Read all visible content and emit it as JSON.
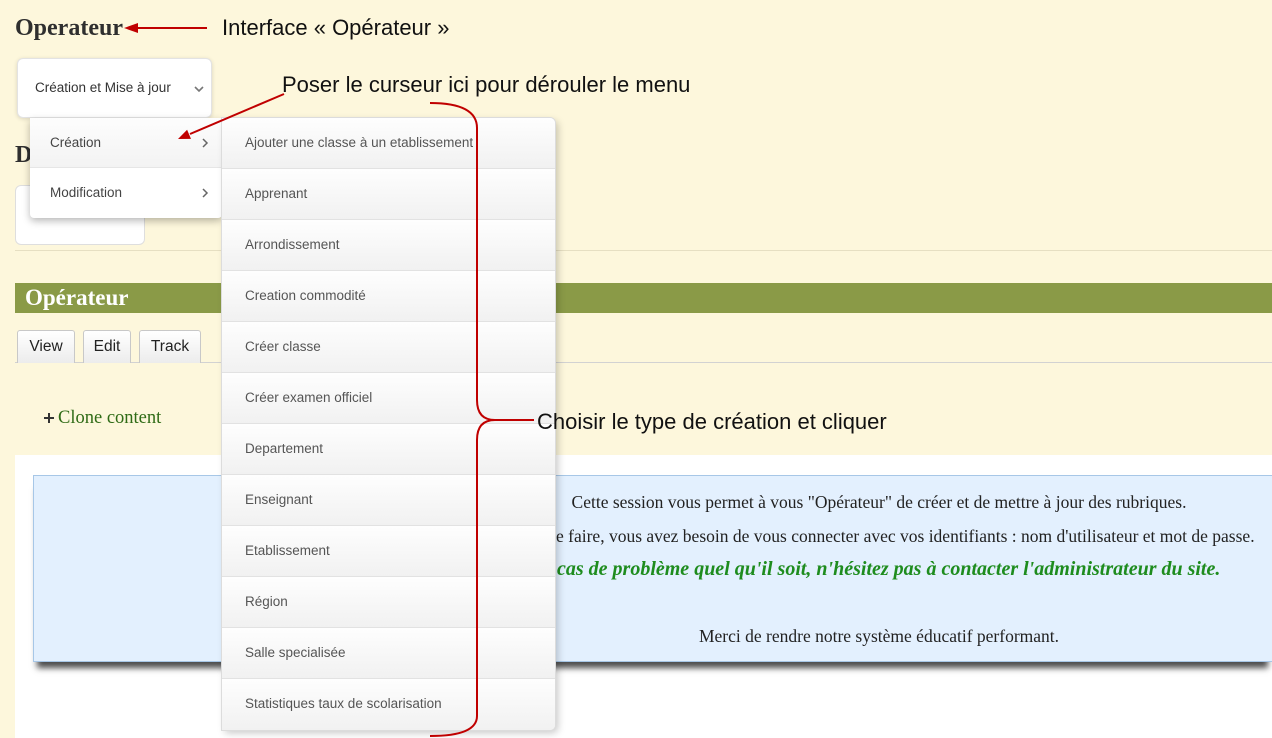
{
  "page": {
    "heading": "Operateur",
    "partial_heading": "D"
  },
  "dropdown": {
    "label": "Création et Mise à jour",
    "menu": [
      "Création",
      "Modification"
    ],
    "submenu": [
      "Ajouter une classe à un etablissement",
      "Apprenant",
      "Arrondissement",
      "Creation commodité",
      "Créer classe",
      "Créer examen officiel",
      "Departement",
      "Enseignant",
      "Etablissement",
      "Région",
      "Salle specialisée",
      "Statistiques taux de scolarisation"
    ]
  },
  "node": {
    "title": "Opérateur",
    "tabs": [
      "View",
      "Edit",
      "Track"
    ],
    "clone_link": "Clone content"
  },
  "info_box": {
    "lines": [
      "Cette session vous permet à vous \"Opérateur\" de créer et de mettre à jour des rubriques.",
      "e faire, vous avez besoin de vous connecter avec vos identifiants : nom d'utilisateur et mot de passe.",
      "cas de problème quel qu'il soit, n'hésitez pas à contacter l'administrateur du site.",
      "Merci de rendre notre système éducatif performant."
    ]
  },
  "annotations": {
    "interface_label": "Interface « Opérateur »",
    "hover_hint": "Poser le curseur ici pour dérouler le menu",
    "choose_hint": "Choisir le type de création et cliquer"
  },
  "icons": {
    "dropdown": "chevron-down-icon",
    "menu_submenu": "chevron-right-icon",
    "clone": "plus-icon"
  },
  "colors": {
    "page_background": "#FDF7DC",
    "title_bar": "#8A9A47",
    "info_box": "#E3F0FE",
    "warning_text": "#1E8C1E",
    "link": "#2F6B16",
    "annotation": "#C00000"
  }
}
